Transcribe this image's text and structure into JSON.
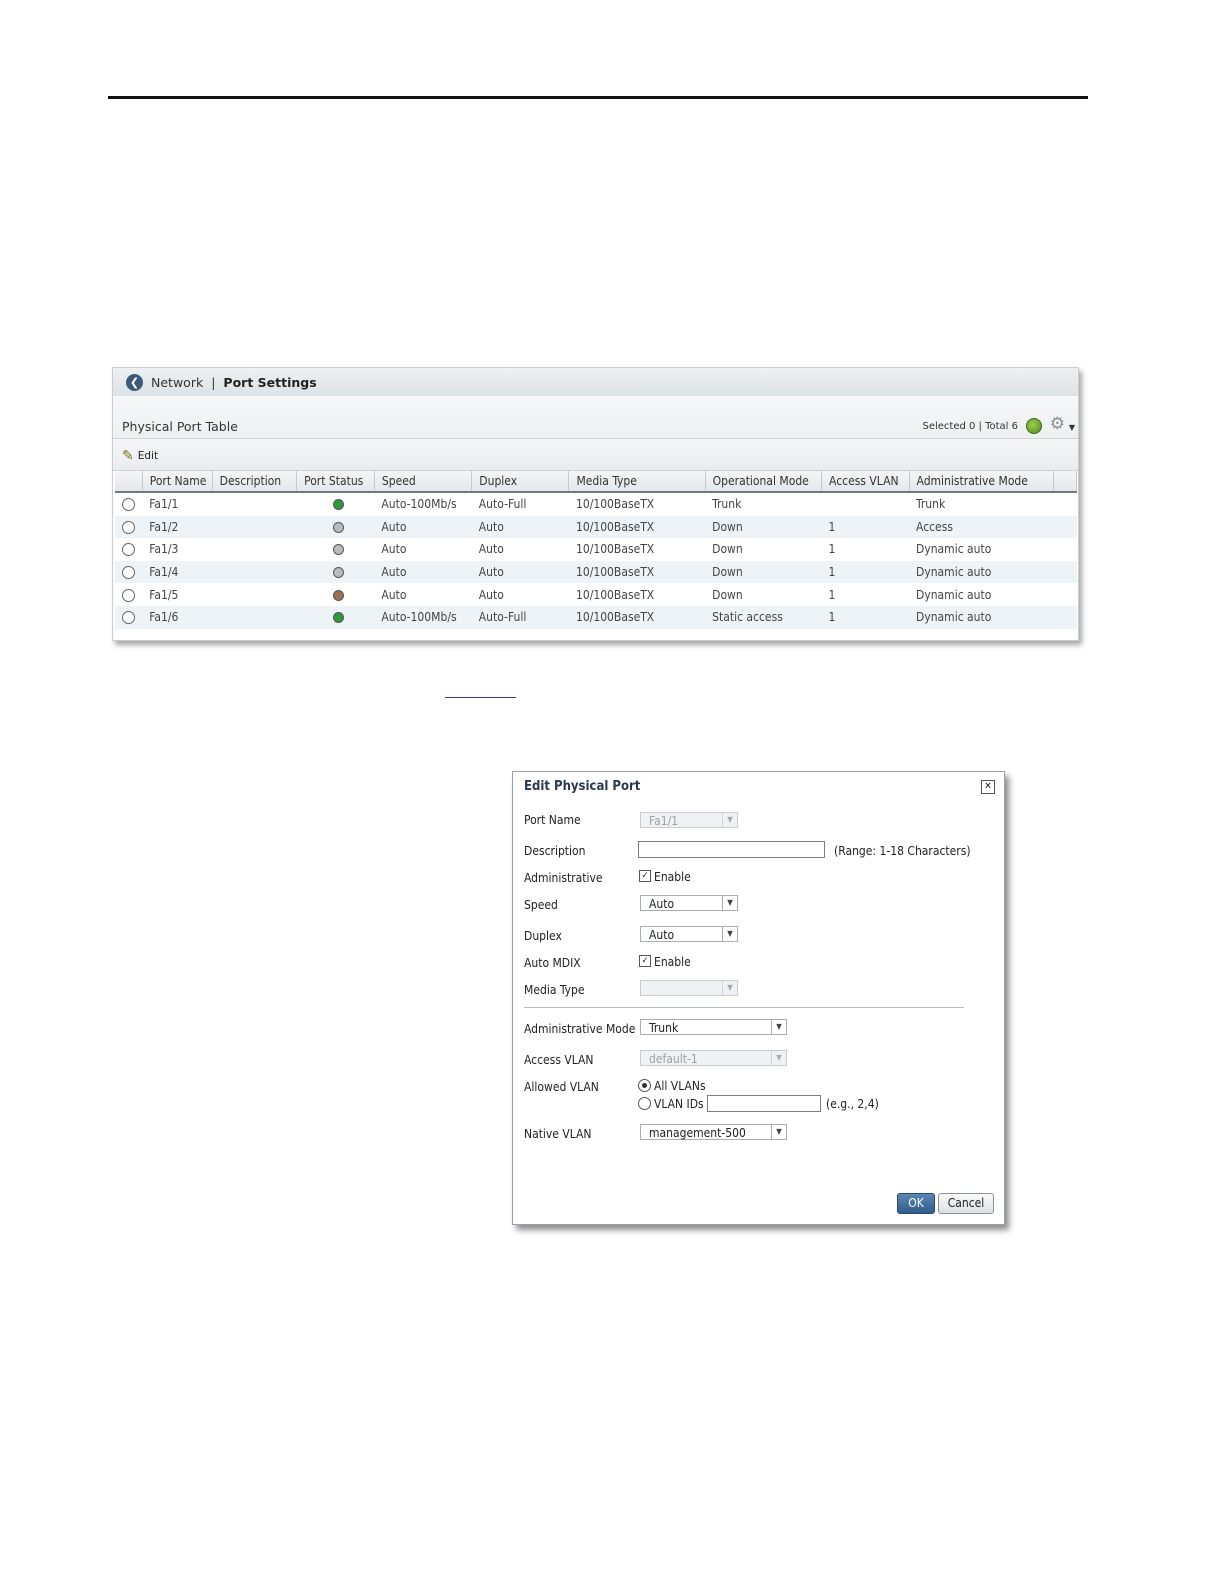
{
  "breadcrumb": {
    "root": "Network",
    "separator": "|",
    "current": "Port Settings"
  },
  "table_section": {
    "title": "Physical Port Table",
    "selection_summary": "Selected 0 | Total 6",
    "edit_label": "Edit"
  },
  "port_table": {
    "headers": [
      "Port Name",
      "Description",
      "Port Status",
      "Speed",
      "Duplex",
      "Media Type",
      "Operational Mode",
      "Access VLAN",
      "Administrative Mode"
    ],
    "rows": [
      {
        "port": "Fa1/1",
        "description": "",
        "status_color": "#2e9a3a",
        "speed": "Auto-100Mb/s",
        "duplex": "Auto-Full",
        "media": "10/100BaseTX",
        "op_mode": "Trunk",
        "access_vlan": "",
        "admin_mode": "Trunk"
      },
      {
        "port": "Fa1/2",
        "description": "",
        "status_color": "#b9bcbf",
        "speed": "Auto",
        "duplex": "Auto",
        "media": "10/100BaseTX",
        "op_mode": "Down",
        "access_vlan": "1",
        "admin_mode": "Access"
      },
      {
        "port": "Fa1/3",
        "description": "",
        "status_color": "#b9bcbf",
        "speed": "Auto",
        "duplex": "Auto",
        "media": "10/100BaseTX",
        "op_mode": "Down",
        "access_vlan": "1",
        "admin_mode": "Dynamic auto"
      },
      {
        "port": "Fa1/4",
        "description": "",
        "status_color": "#b9bcbf",
        "speed": "Auto",
        "duplex": "Auto",
        "media": "10/100BaseTX",
        "op_mode": "Down",
        "access_vlan": "1",
        "admin_mode": "Dynamic auto"
      },
      {
        "port": "Fa1/5",
        "description": "",
        "status_color": "#9a7355",
        "speed": "Auto",
        "duplex": "Auto",
        "media": "10/100BaseTX",
        "op_mode": "Down",
        "access_vlan": "1",
        "admin_mode": "Dynamic auto"
      },
      {
        "port": "Fa1/6",
        "description": "",
        "status_color": "#2e9a3a",
        "speed": "Auto-100Mb/s",
        "duplex": "Auto-Full",
        "media": "10/100BaseTX",
        "op_mode": "Static access",
        "access_vlan": "1",
        "admin_mode": "Dynamic auto"
      }
    ]
  },
  "dialog": {
    "title": "Edit Physical Port",
    "close_icon": "✕",
    "port_name": {
      "label": "Port Name",
      "value": "Fa1/1"
    },
    "description": {
      "label": "Description",
      "value": "",
      "hint": "(Range: 1-18 Characters)"
    },
    "administrative": {
      "label": "Administrative",
      "checkbox_label": "Enable",
      "checked": true
    },
    "speed": {
      "label": "Speed",
      "value": "Auto"
    },
    "duplex": {
      "label": "Duplex",
      "value": "Auto"
    },
    "auto_mdix": {
      "label": "Auto MDIX",
      "checkbox_label": "Enable",
      "checked": true
    },
    "media_type": {
      "label": "Media Type",
      "value": ""
    },
    "admin_mode": {
      "label": "Administrative Mode",
      "value": "Trunk"
    },
    "access_vlan": {
      "label": "Access VLAN",
      "value": "default-1"
    },
    "allowed_vlan": {
      "label": "Allowed VLAN",
      "option_all": "All VLANs",
      "option_ids": "VLAN IDs",
      "ids_value": "",
      "ids_hint": "(e.g., 2,4)"
    },
    "native_vlan": {
      "label": "Native VLAN",
      "value": "management-500"
    },
    "ok_label": "OK",
    "cancel_label": "Cancel"
  },
  "colors": {
    "accent": "#3d5a7c",
    "ok_button": "#315d8d",
    "row_alt": "#eef3f8"
  }
}
